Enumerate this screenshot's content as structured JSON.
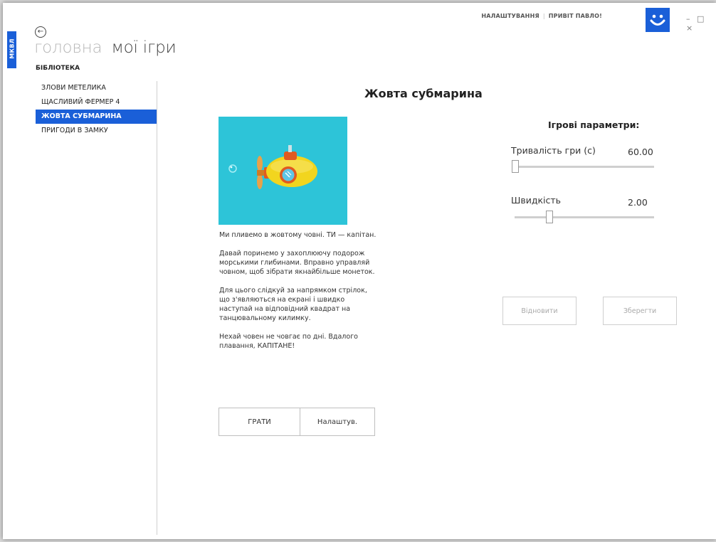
{
  "header": {
    "side_tab": "МКВЛ",
    "breadcrumb_home": "головна",
    "breadcrumb_current": "мої ігри",
    "library_label": "БІБЛІОТЕКА",
    "settings_link": "НАЛАШТУВАННЯ",
    "greeting": "ПРИВІТ ПАВЛО!",
    "window_controls": "– □ ×"
  },
  "sidebar": {
    "items": [
      {
        "label": "ЗЛОВИ МЕТЕЛИКА"
      },
      {
        "label": "ЩАСЛИВИЙ ФЕРМЕР 4"
      },
      {
        "label": "ЖОВТА СУБМАРИНА",
        "active": true
      },
      {
        "label": "ПРИГОДИ В ЗАМКУ"
      }
    ]
  },
  "game": {
    "title": "Жовта субмарина",
    "description": [
      "Ми пливемо в жовтому човні. ТИ — капітан.",
      "Давай поринемо у захоплюючу подорож морськими глибинами. Вправно управляй човном, щоб зібрати якнайбільше монеток.",
      "Для цього слідкуй за напрямком стрілок, що з'являються на екрані і швидко наступай на відповідний квадрат на танцювальному килимку.",
      "Нехай човен не човгає по дні. Вдалого плавання, КАПІТАНЕ!"
    ],
    "play_button": "ГРАТИ",
    "settings_button": "Налаштув."
  },
  "params": {
    "title": "Ігрові параметри:",
    "duration_label": "Тривалість гри (с)",
    "duration_value": "60.00",
    "duration_level": 0.0,
    "speed_label": "Швидкість",
    "speed_value": "2.00",
    "speed_level": 0.25,
    "reset_button": "Відновити",
    "save_button": "Зберегти"
  },
  "colors": {
    "accent": "#1a5fd8",
    "image_bg": "#2dc4d8",
    "submarine": "#f2d51e"
  }
}
